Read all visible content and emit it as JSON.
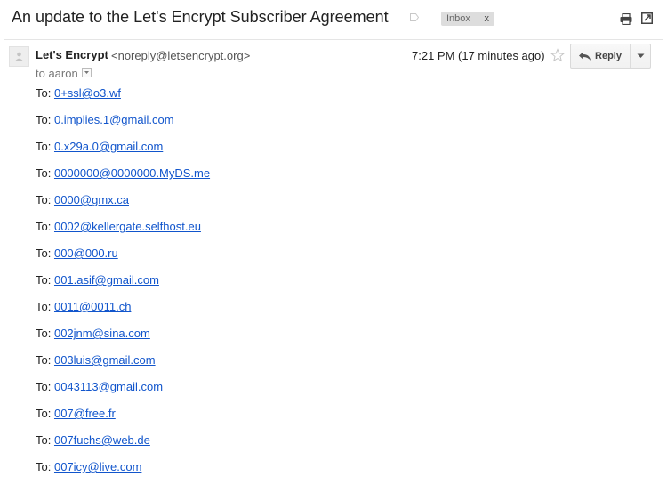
{
  "subject": "An update to the Let's Encrypt Subscriber Agreement",
  "label_badge": {
    "text": "Inbox",
    "remove": "x"
  },
  "icons": {
    "label": "label-tag-icon",
    "print": "print-icon",
    "new_window": "new-window-icon",
    "avatar": "avatar-icon",
    "star": "star-icon",
    "reply": "reply-arrow-icon",
    "more": "dropdown-arrow-icon",
    "details": "show-details-icon"
  },
  "message": {
    "sender_name": "Let's Encrypt",
    "sender_email": "<noreply@letsencrypt.org>",
    "to_line": "to aaron",
    "timestamp": "7:21 PM (17 minutes ago)",
    "reply_label": "Reply"
  },
  "body": {
    "recipient_prefix": "To:",
    "recipients": [
      "0+ssl@o3.wf",
      "0.implies.1@gmail.com",
      "0.x29a.0@gmail.com",
      "0000000@0000000.MyDS.me",
      "0000@gmx.ca",
      "0002@kellergate.selfhost.eu",
      "000@000.ru",
      "001.asif@gmail.com",
      "0011@0011.ch",
      "002jnm@sina.com",
      "003luis@gmail.com",
      "0043113@gmail.com",
      "007@free.fr",
      "007fuchs@web.de",
      "007icy@live.com"
    ]
  },
  "colors": {
    "link": "#1155cc",
    "badge_bg": "#dddddd",
    "text": "#222222",
    "muted": "#777777"
  }
}
